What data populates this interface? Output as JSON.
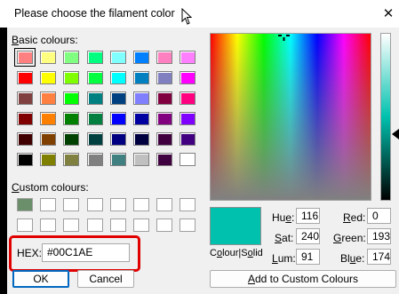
{
  "window": {
    "title": "Please choose the filament color",
    "close_glyph": "✕"
  },
  "basic": {
    "label_u": "B",
    "label_rest": "asic colours:",
    "colors": [
      [
        "#ff8080",
        "#ffff80",
        "#80ff80",
        "#00ff80",
        "#80ffff",
        "#0080ff",
        "#ff80c0",
        "#ff80ff"
      ],
      [
        "#ff0000",
        "#ffff00",
        "#80ff00",
        "#00ff40",
        "#00ffff",
        "#0080c0",
        "#8080c0",
        "#ff00ff"
      ],
      [
        "#804040",
        "#ff8040",
        "#00ff00",
        "#008080",
        "#004080",
        "#8080ff",
        "#800040",
        "#ff0080"
      ],
      [
        "#800000",
        "#ff8000",
        "#008000",
        "#008040",
        "#0000ff",
        "#0000a0",
        "#800080",
        "#8000ff"
      ],
      [
        "#400000",
        "#804000",
        "#004000",
        "#004040",
        "#000080",
        "#000040",
        "#400040",
        "#400080"
      ],
      [
        "#000000",
        "#808000",
        "#808040",
        "#808080",
        "#408080",
        "#c0c0c0",
        "#400040",
        "#ffffff"
      ]
    ]
  },
  "custom": {
    "label_u": "C",
    "label_rest": "ustom colours:",
    "colors": [
      [
        "#6b8e6b",
        "#ffffff",
        "#ffffff",
        "#ffffff",
        "#ffffff",
        "#ffffff",
        "#ffffff",
        "#ffffff"
      ],
      [
        "#ffffff",
        "#ffffff",
        "#ffffff",
        "#ffffff",
        "#ffffff",
        "#ffffff",
        "#ffffff",
        "#ffffff"
      ]
    ]
  },
  "hex": {
    "label": "HEX:",
    "value": "#00C1AE"
  },
  "buttons": {
    "ok": "OK",
    "cancel": "Cancel",
    "add": "Add to Custom Colours",
    "add_u": "A",
    "add_rest": "dd to Custom Colours"
  },
  "preview": {
    "color": "#00c1ae",
    "label": "Colour|Solid",
    "label_u": "o"
  },
  "fields": {
    "hue": {
      "label_pre": "Hu",
      "label_u": "e",
      "label_post": ":",
      "value": "116"
    },
    "sat": {
      "label_pre": "",
      "label_u": "S",
      "label_post": "at:",
      "value": "240"
    },
    "lum": {
      "label_pre": "",
      "label_u": "L",
      "label_post": "um:",
      "value": "91"
    },
    "red": {
      "label_pre": "",
      "label_u": "R",
      "label_post": "ed:",
      "value": "0"
    },
    "green": {
      "label_pre": "",
      "label_u": "G",
      "label_post": "reen:",
      "value": "193"
    },
    "blue": {
      "label_pre": "Bl",
      "label_u": "u",
      "label_post": "e:",
      "value": "174"
    }
  },
  "icons": {
    "close": "close-icon",
    "cursor": "mouse-pointer-icon",
    "crosshair": "crosshair-icon",
    "lum_arrow": "luminance-pointer-icon"
  }
}
